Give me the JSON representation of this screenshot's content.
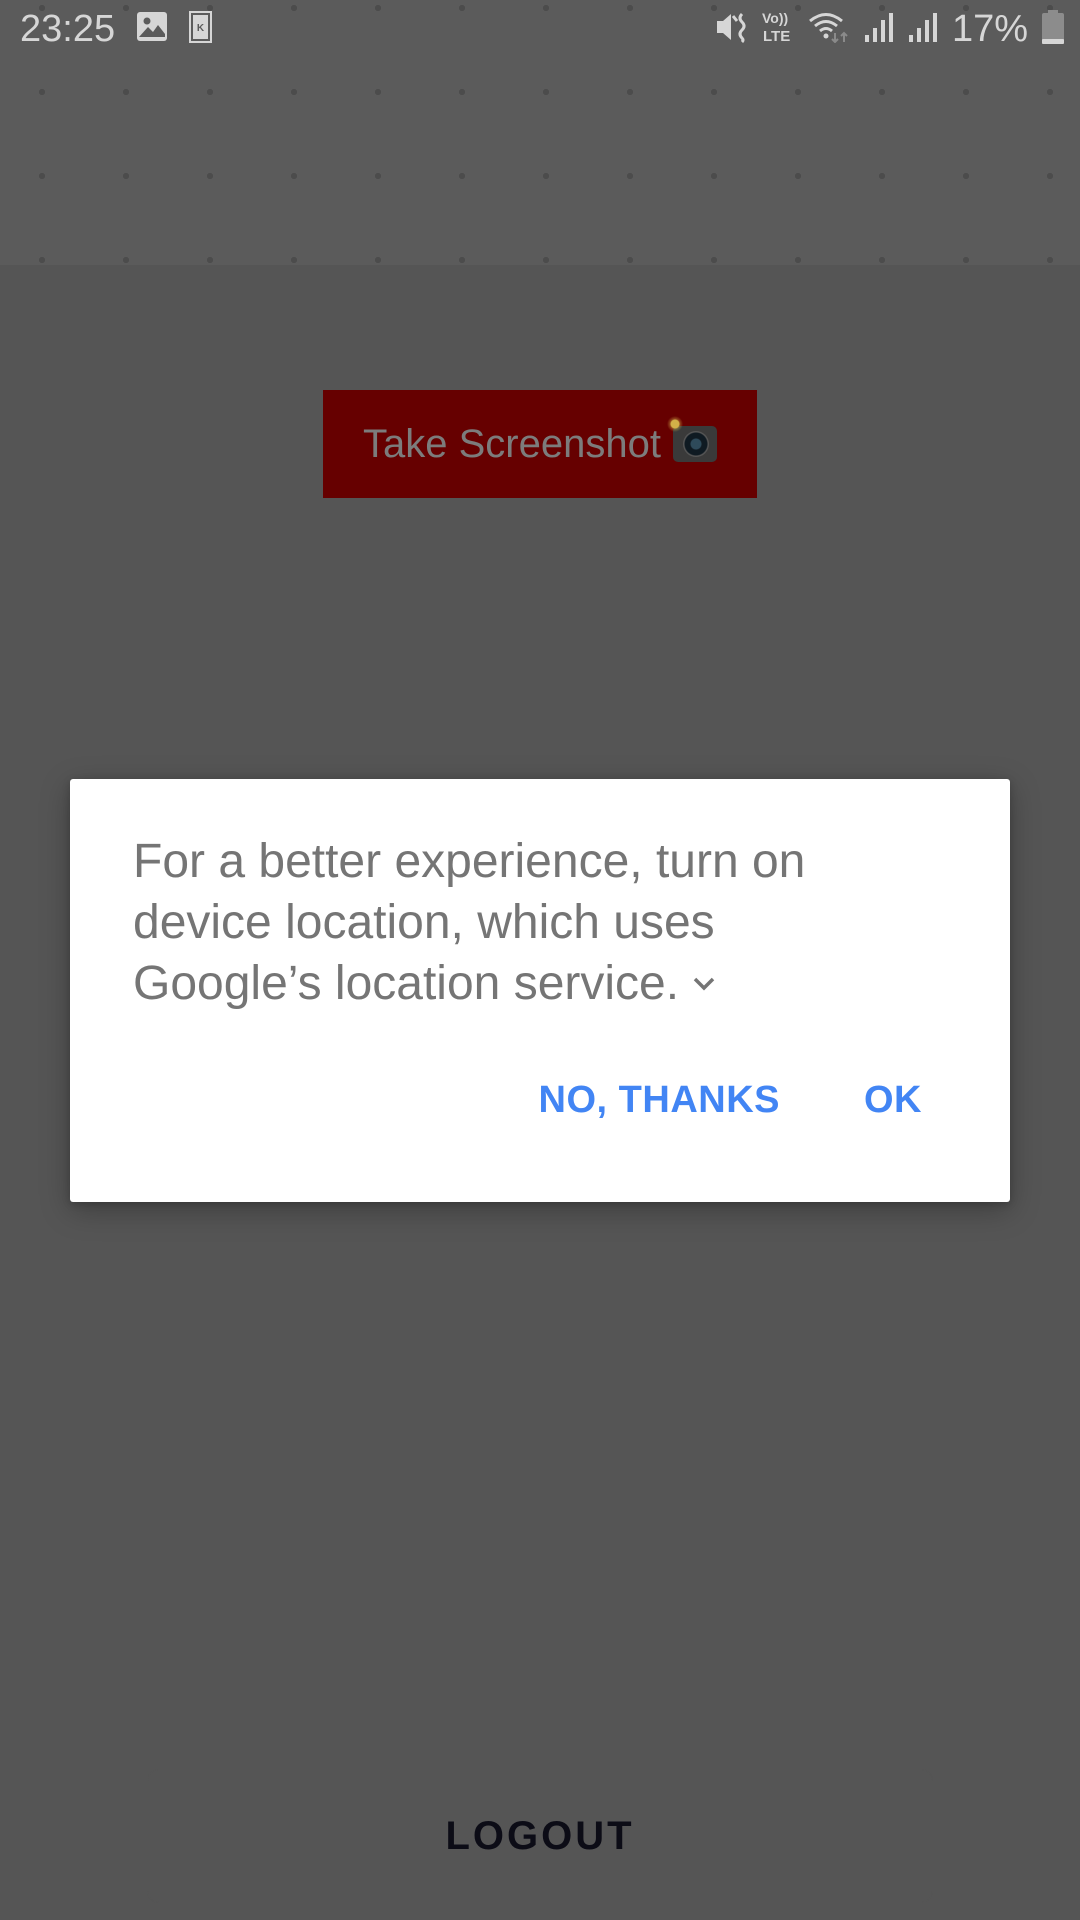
{
  "status_bar": {
    "time": "23:25",
    "left_icons": [
      "gallery-notification-icon",
      "k-app-notification-icon"
    ],
    "right_icons": [
      "mute-vibrate-icon",
      "volte-icon",
      "wifi-icon",
      "signal-sim1-icon",
      "signal-sim2-icon"
    ],
    "volte_line1": "Vo))",
    "volte_line2": "LTE",
    "battery_percent": "17%",
    "battery_level": 0.17
  },
  "main": {
    "screenshot_button_label": "Take Screenshot",
    "screenshot_button_emoji": "camera-with-flash-icon",
    "logout_label": "LOGOUT"
  },
  "dialog": {
    "message": "For a better experience, turn on device location, which uses Google’s location service.",
    "expand_icon": "chevron-down-icon",
    "negative_label": "NO, THANKS",
    "positive_label": "OK"
  },
  "colors": {
    "scrim_background": "#666666",
    "header_band": "#5b5b5b",
    "screenshot_button_bg": "#660000",
    "dialog_action": "#4285f4",
    "dialog_text": "#757575"
  }
}
